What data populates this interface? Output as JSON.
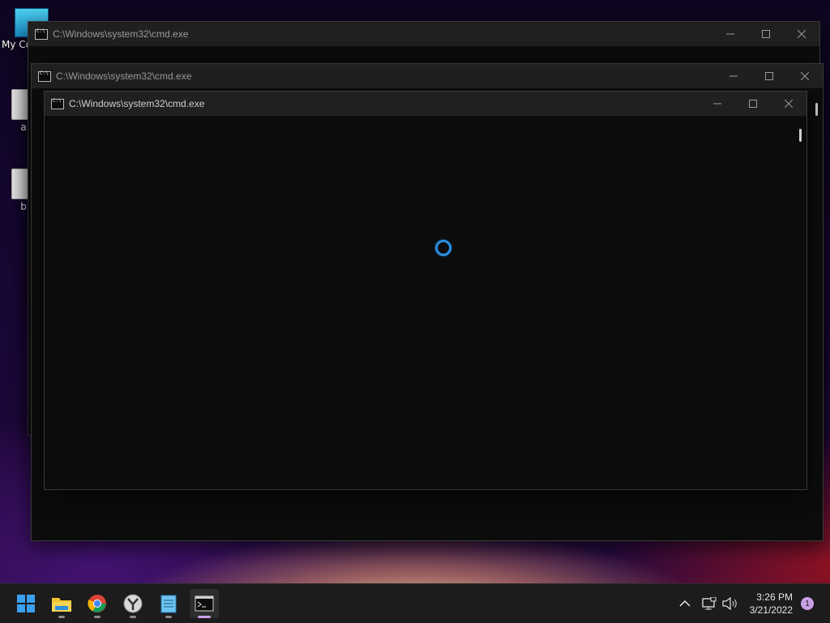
{
  "desktop": {
    "icons": [
      {
        "label": "My Co"
      },
      {
        "label": "a"
      },
      {
        "label": "b"
      }
    ]
  },
  "windows": [
    {
      "title": "C:\\Windows\\system32\\cmd.exe"
    },
    {
      "title": "C:\\Windows\\system32\\cmd.exe"
    },
    {
      "title": "C:\\Windows\\system32\\cmd.exe"
    }
  ],
  "taskbar": {
    "apps": [
      "start-icon",
      "file-explorer-icon",
      "chrome-icon",
      "app-icon",
      "notepad-icon",
      "cmd-icon"
    ],
    "clock": {
      "time": "3:26 PM",
      "date": "3/21/2022"
    },
    "notification_count": "1"
  },
  "colors": {
    "accent": "#2b8fe0",
    "taskbar_bg": "#1c1c1c",
    "titlebar_bg": "#202020",
    "console_bg": "#0c0c0c"
  }
}
